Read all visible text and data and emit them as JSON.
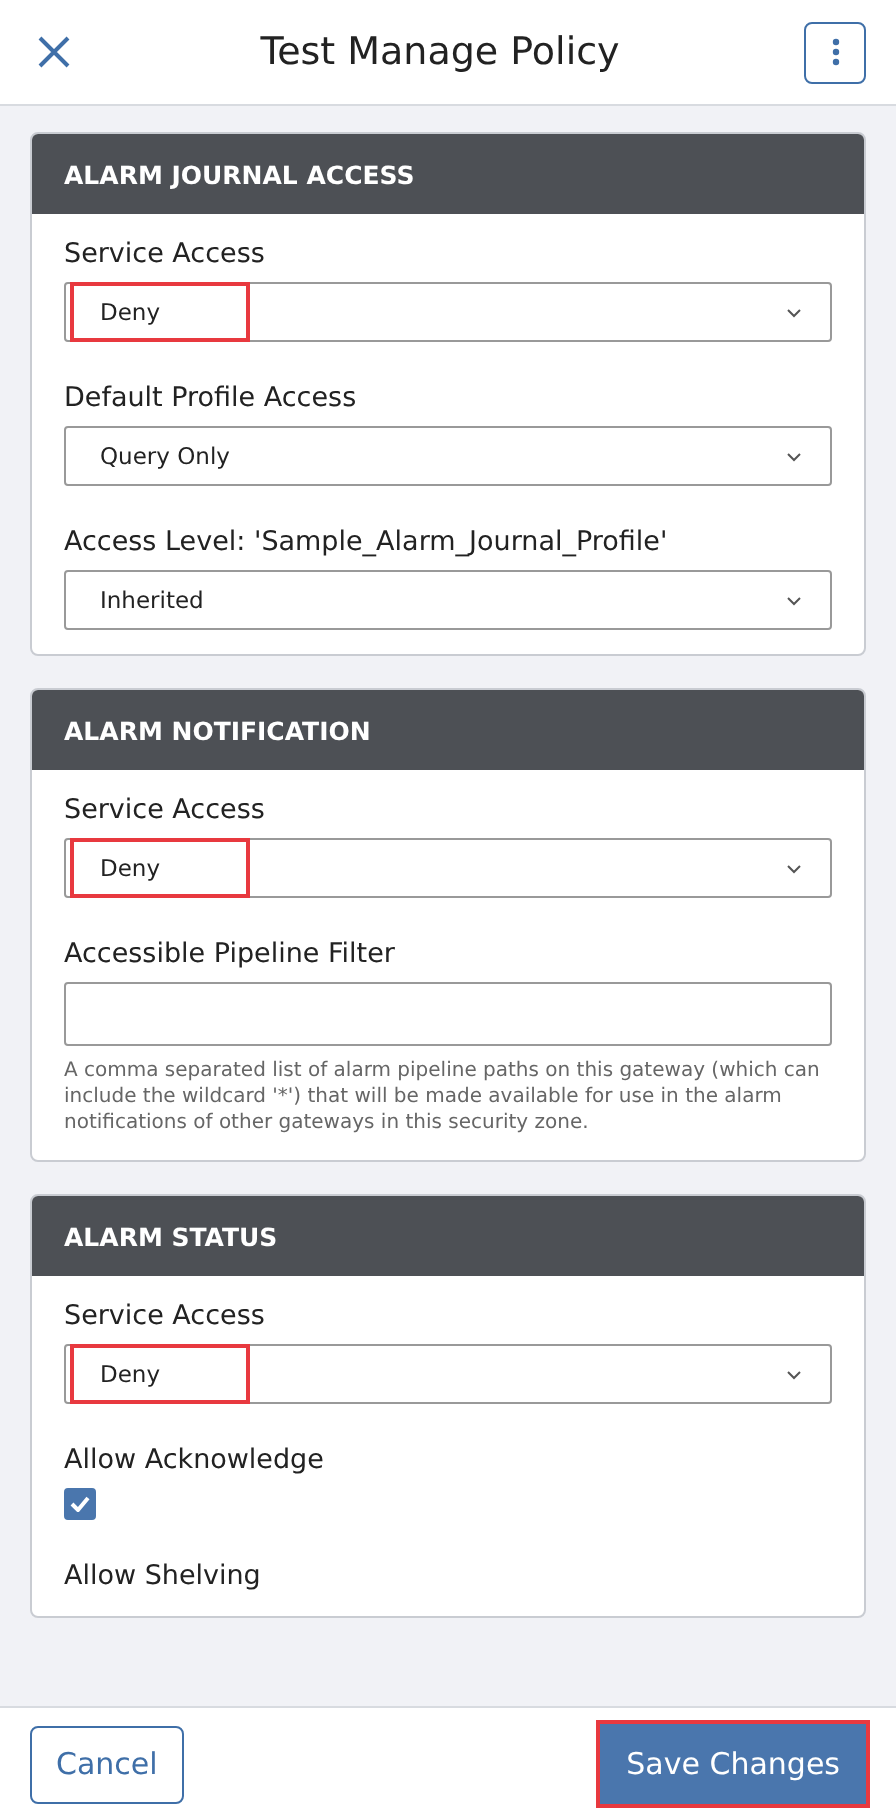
{
  "header": {
    "title": "Test Manage Policy"
  },
  "sections": [
    {
      "title": "ALARM JOURNAL ACCESS",
      "fields": [
        {
          "kind": "select",
          "label": "Service Access",
          "value": "Deny",
          "highlighted": true
        },
        {
          "kind": "select",
          "label": "Default Profile Access",
          "value": "Query Only",
          "highlighted": false
        },
        {
          "kind": "select",
          "label": "Access Level: 'Sample_Alarm_Journal_Profile'",
          "value": "Inherited",
          "highlighted": false
        }
      ]
    },
    {
      "title": "ALARM NOTIFICATION",
      "fields": [
        {
          "kind": "select",
          "label": "Service Access",
          "value": "Deny",
          "highlighted": true
        },
        {
          "kind": "text",
          "label": "Accessible Pipeline Filter",
          "help": "A comma separated list of alarm pipeline paths on this gateway (which can include the wildcard '*') that will be made available for use in the alarm notifications of other gateways in this security zone."
        }
      ]
    },
    {
      "title": "ALARM STATUS",
      "fields": [
        {
          "kind": "select",
          "label": "Service Access",
          "value": "Deny",
          "highlighted": true
        },
        {
          "kind": "checkbox",
          "label": "Allow Acknowledge",
          "checked": true
        },
        {
          "kind": "label",
          "label": "Allow Shelving"
        }
      ]
    }
  ],
  "footer": {
    "cancel": "Cancel",
    "save": "Save Changes",
    "save_highlighted": true
  }
}
